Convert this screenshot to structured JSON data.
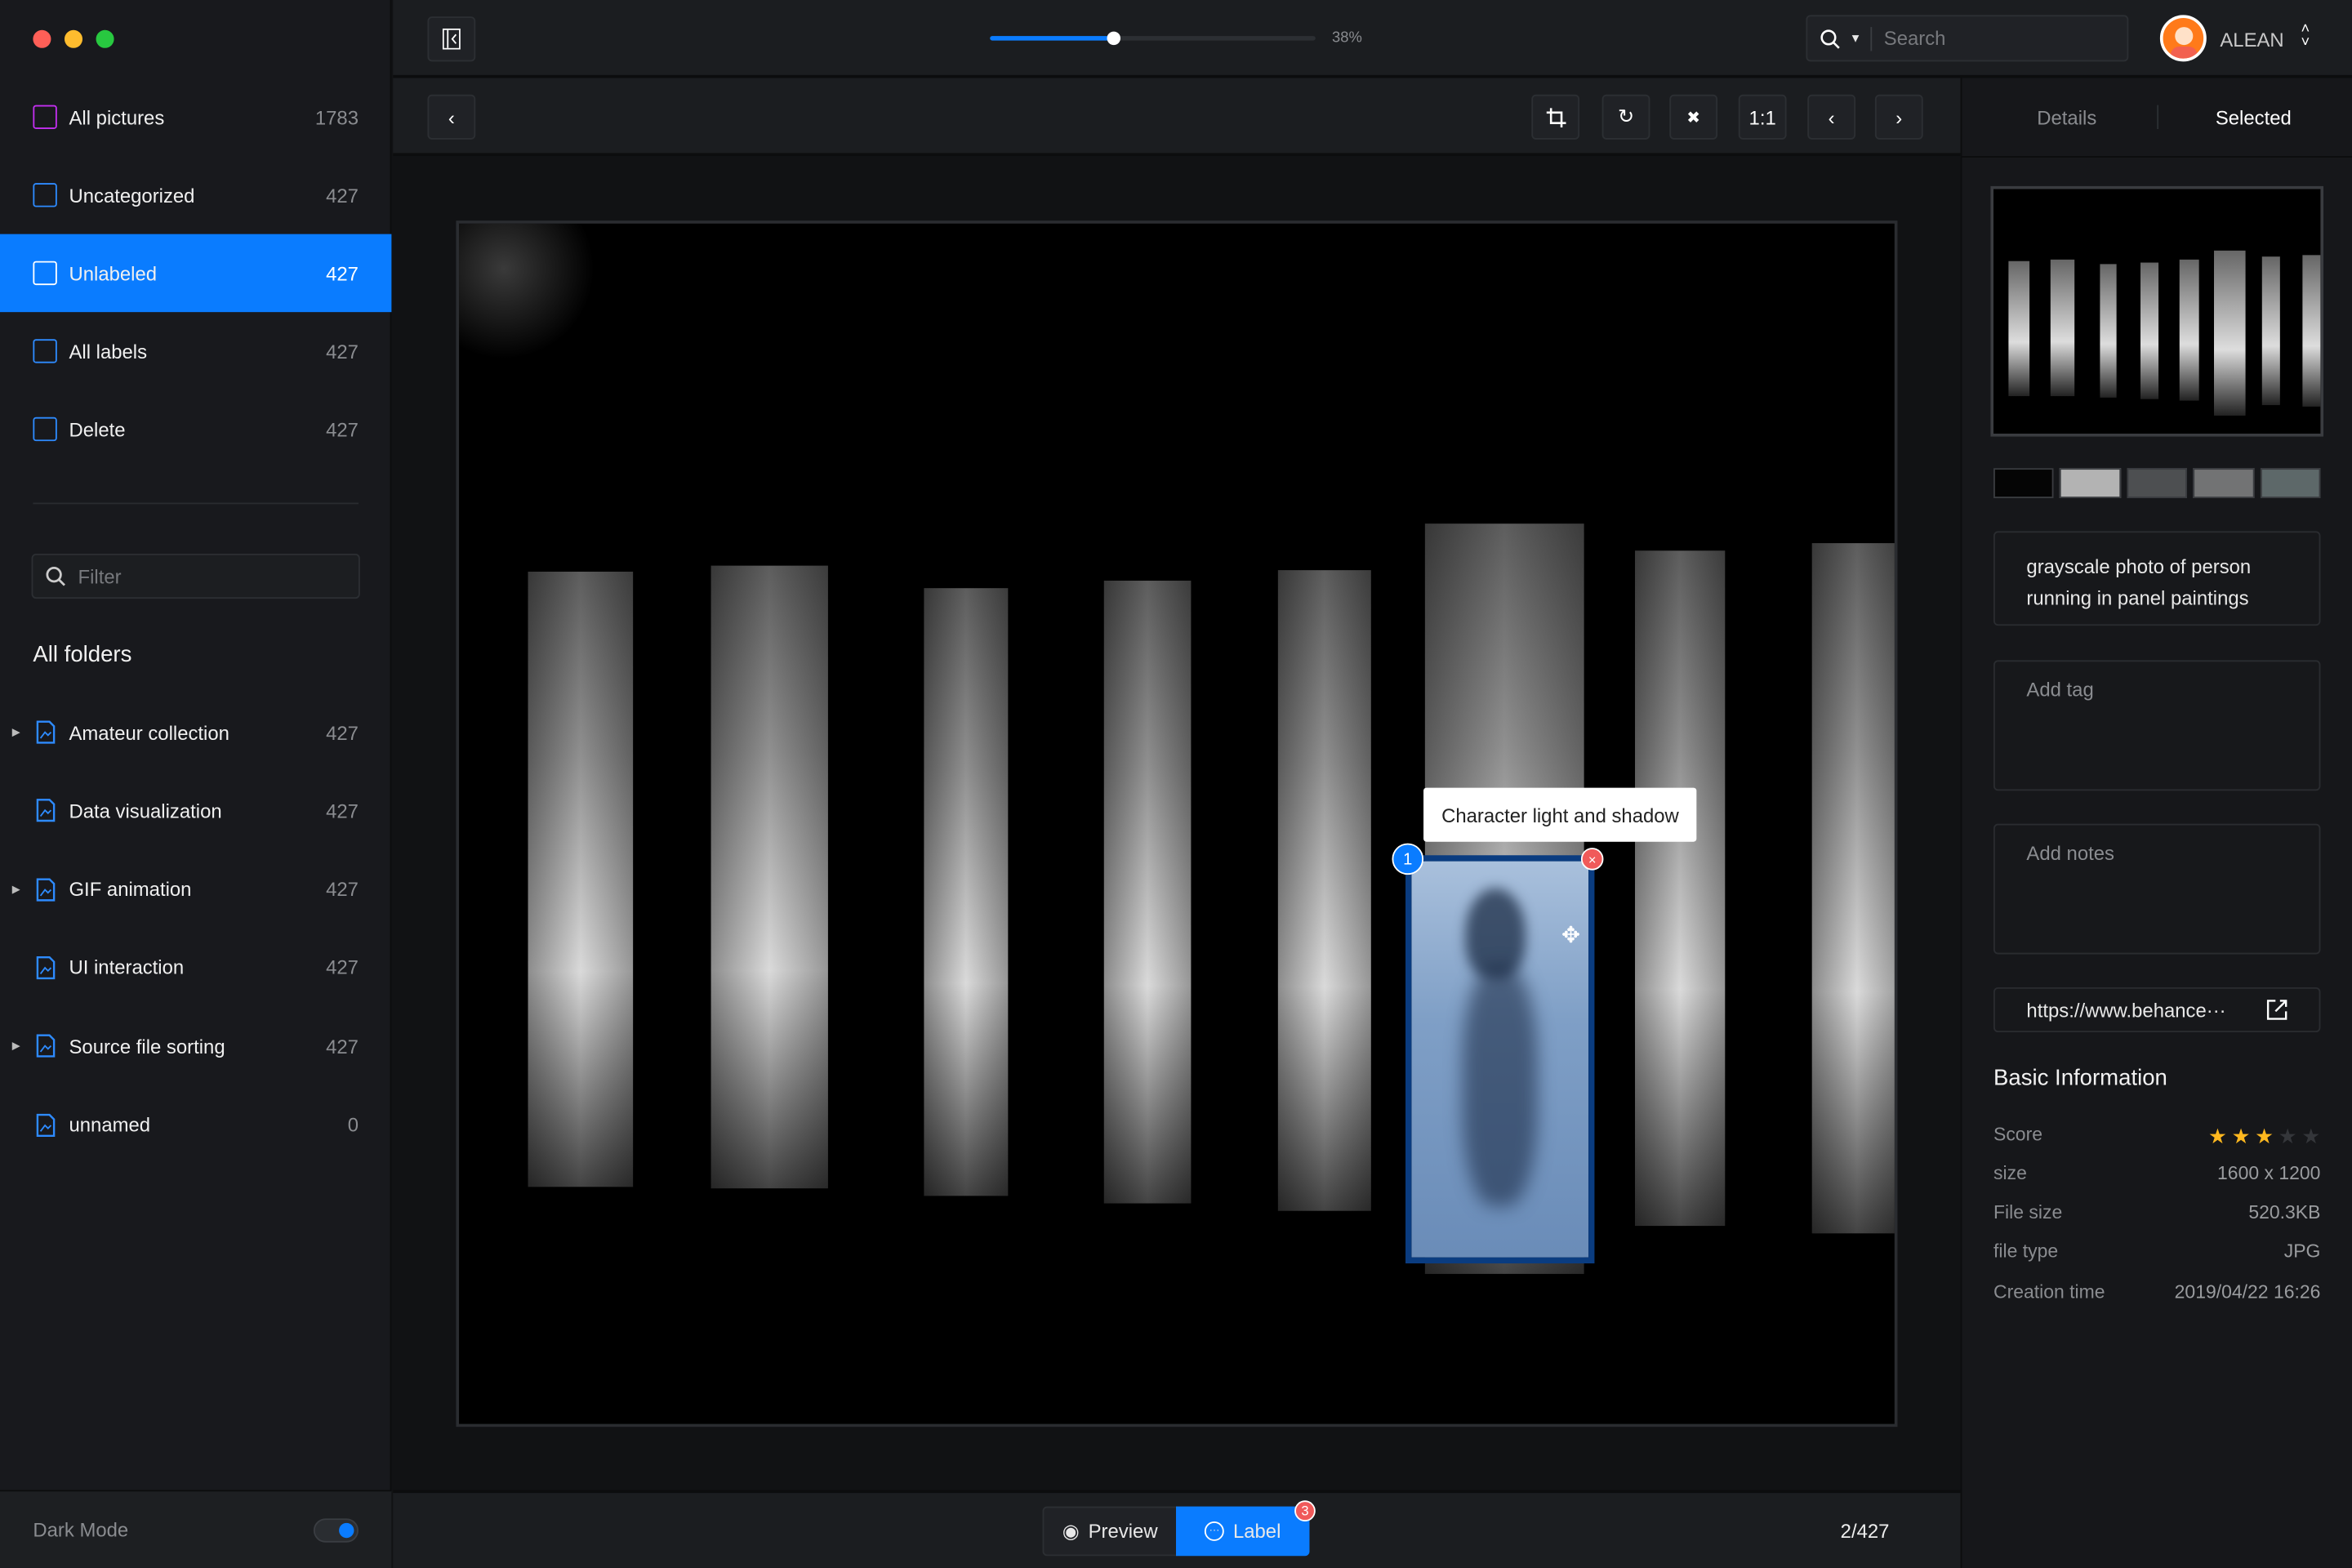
{
  "window": {
    "controls": [
      "close",
      "minimize",
      "maximize"
    ]
  },
  "sidebar": {
    "nav": [
      {
        "label": "All pictures",
        "count": "1783",
        "icon": "pictures-icon",
        "color": "#c22ff0"
      },
      {
        "label": "Uncategorized",
        "count": "427",
        "icon": "uncategorized-icon",
        "color": "#2e8bff"
      },
      {
        "label": "Unlabeled",
        "count": "427",
        "icon": "unlabeled-icon",
        "color": "#ffffff",
        "active": true
      },
      {
        "label": "All labels",
        "count": "427",
        "icon": "labels-icon",
        "color": "#2e8bff"
      },
      {
        "label": "Delete",
        "count": "427",
        "icon": "trash-icon",
        "color": "#2e8bff"
      }
    ],
    "filter_placeholder": "Filter",
    "folders_title": "All folders",
    "folders": [
      {
        "label": "Amateur collection",
        "count": "427",
        "expandable": true
      },
      {
        "label": "Data visualization",
        "count": "427",
        "expandable": false
      },
      {
        "label": "GIF animation",
        "count": "427",
        "expandable": true
      },
      {
        "label": "UI interaction",
        "count": "427",
        "expandable": false
      },
      {
        "label": "Source file sorting",
        "count": "427",
        "expandable": true
      },
      {
        "label": "unnamed",
        "count": "0",
        "expandable": false
      }
    ],
    "dark_mode_label": "Dark Mode",
    "dark_mode_on": true
  },
  "topbar": {
    "zoom_percent": 38,
    "zoom_label": "38%",
    "search_placeholder": "Search",
    "user_name": "ALEAN"
  },
  "toolbar": {
    "ratio_label": "1:1"
  },
  "canvas": {
    "annotation_label": "Character light and shadow",
    "annotation_index": "1"
  },
  "bottom": {
    "preview_label": "Preview",
    "label_label": "Label",
    "label_badge": "3",
    "pager": "2/427"
  },
  "right": {
    "tabs": [
      "Details",
      "Selected"
    ],
    "active_tab": "Selected",
    "palette": [
      "#050505",
      "#b3b3b3",
      "#4d4f51",
      "#727374",
      "#5d6869"
    ],
    "description": "grayscale photo of person running in panel paintings",
    "tag_placeholder": "Add tag",
    "notes_placeholder": "Add notes",
    "link": "https://www.behance···",
    "basic_title": "Basic Information",
    "score_label": "Score",
    "score": 3,
    "score_max": 5,
    "rows": [
      {
        "k": "size",
        "v": "1600 x 1200"
      },
      {
        "k": "File size",
        "v": "520.3KB"
      },
      {
        "k": "file type",
        "v": "JPG"
      },
      {
        "k": "Creation time",
        "v": "2019/04/22 16:26"
      }
    ]
  },
  "colors": {
    "accent": "#0a7cff",
    "badge": "#f05a5a",
    "star": "#ffb81f"
  }
}
